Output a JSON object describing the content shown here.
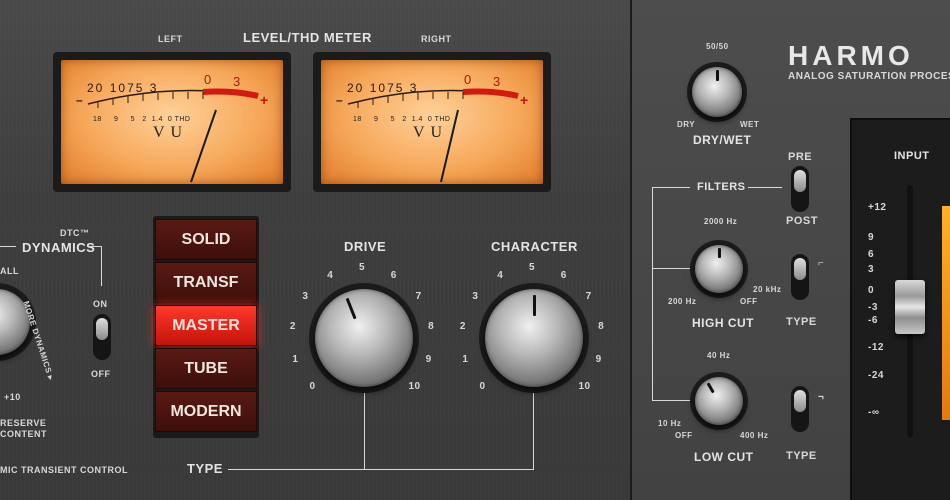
{
  "meter": {
    "title": "LEVEL/THD METER",
    "left_label": "LEFT",
    "right_label": "RIGHT",
    "scale_top": [
      "20",
      "10",
      "7",
      "5",
      "3",
      "0",
      "3"
    ],
    "scale_bottom": [
      "18",
      "9",
      "5",
      "2",
      "1.4",
      "0",
      "THD"
    ],
    "minus": "–",
    "plus": "+",
    "vu_text": "VU"
  },
  "dynamics": {
    "tm": "DTC™",
    "label": "DYNAMICS",
    "on": "ON",
    "off": "OFF",
    "more": "MORE DYNAMICS ▸",
    "all": "ALL",
    "plus10": "+10",
    "reserve": "RESERVE",
    "content": "CONTENT",
    "footer": "MIC TRANSIENT CONTROL"
  },
  "type_select": {
    "label": "TYPE",
    "options": [
      "SOLID",
      "TRANSF",
      "MASTER",
      "TUBE",
      "MODERN"
    ],
    "selected": "MASTER"
  },
  "drive": {
    "label": "DRIVE",
    "ticks": [
      "0",
      "1",
      "2",
      "3",
      "4",
      "5",
      "6",
      "7",
      "8",
      "9",
      "10"
    ],
    "value": 4.2
  },
  "character": {
    "label": "CHARACTER",
    "ticks": [
      "0",
      "1",
      "2",
      "3",
      "4",
      "5",
      "6",
      "7",
      "8",
      "9",
      "10"
    ],
    "value": 5
  },
  "brand": {
    "name": "HARMO",
    "tagline": "ANALOG SATURATION PROCES"
  },
  "drywet": {
    "label": "DRY/WET",
    "top": "50/50",
    "dry": "DRY",
    "wet": "WET"
  },
  "filters": {
    "label": "FILTERS",
    "pre": "PRE",
    "post": "POST",
    "type_label": "TYPE",
    "high_cut": {
      "label": "HIGH CUT",
      "top": "2000 Hz",
      "min": "200 Hz",
      "max": "20 kHz",
      "off": "OFF"
    },
    "low_cut": {
      "label": "LOW CUT",
      "top": "40 Hz",
      "min": "10 Hz",
      "off": "OFF",
      "max": "400 Hz"
    }
  },
  "input": {
    "label": "INPUT",
    "scale": [
      "+12",
      "9",
      "6",
      "3",
      "0",
      "-3",
      "-6",
      "-12",
      "-24",
      "-∞"
    ]
  },
  "colors": {
    "accent": "#e8241a",
    "meter_amber": "#f6a85a"
  }
}
